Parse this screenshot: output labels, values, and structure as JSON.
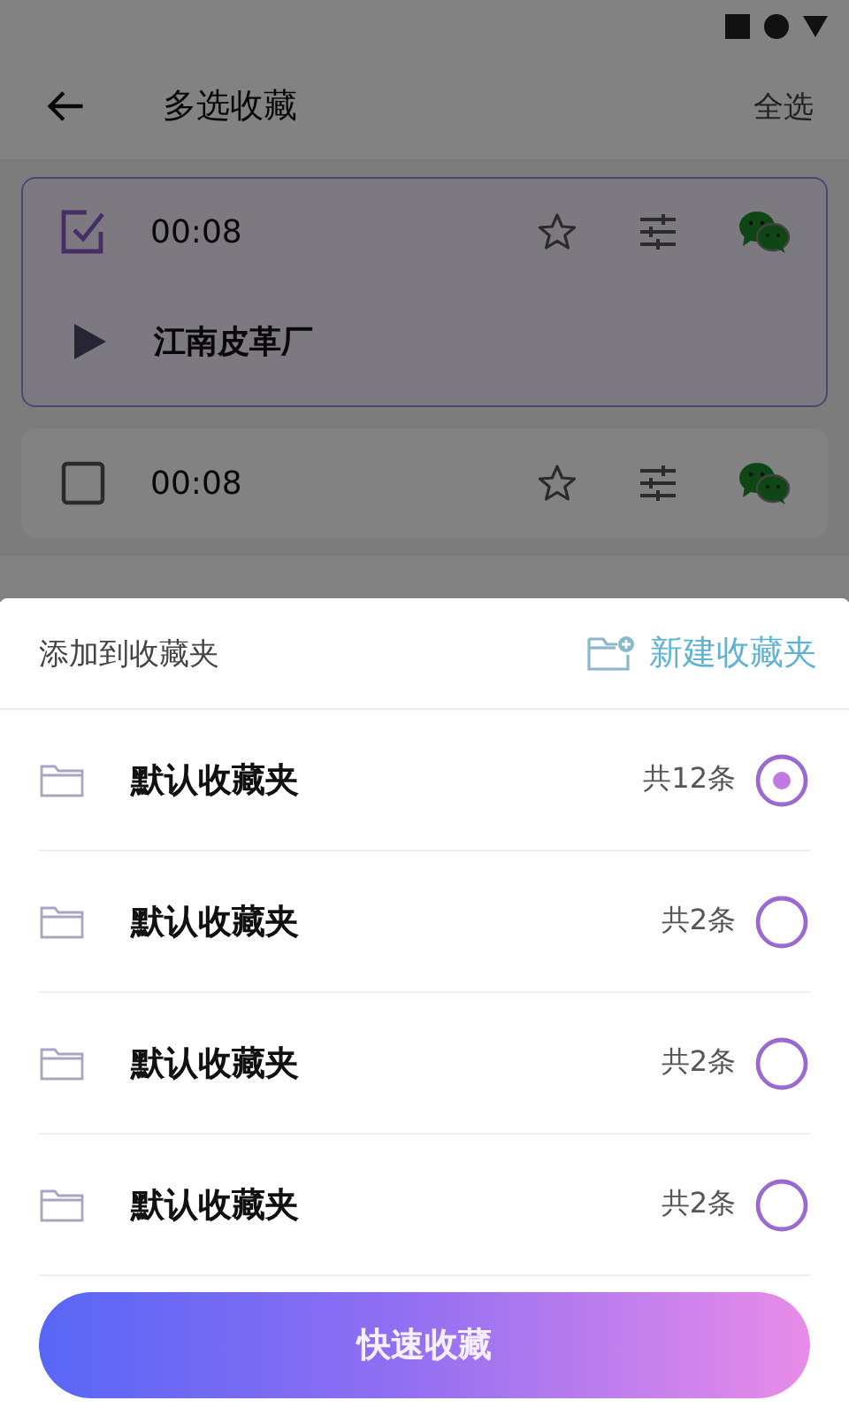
{
  "header": {
    "title": "多选收藏",
    "action": "全选"
  },
  "recordings": [
    {
      "time": "00:08",
      "checked": true,
      "title": "江南皮革厂"
    },
    {
      "time": "00:08",
      "checked": false
    }
  ],
  "sheet": {
    "title": "添加到收藏夹",
    "new_folder": "新建收藏夹",
    "folders": [
      {
        "name": "默认收藏夹",
        "count": "共12条",
        "selected": true
      },
      {
        "name": "默认收藏夹",
        "count": "共2条",
        "selected": false
      },
      {
        "name": "默认收藏夹",
        "count": "共2条",
        "selected": false
      },
      {
        "name": "默认收藏夹",
        "count": "共2条",
        "selected": false
      }
    ],
    "button": "快速收藏"
  }
}
